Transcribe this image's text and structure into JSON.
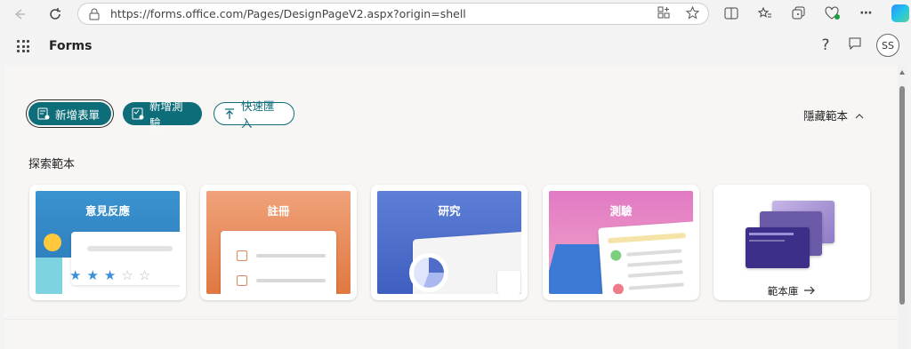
{
  "browser": {
    "url": "https://forms.office.com/Pages/DesignPageV2.aspx?origin=shell"
  },
  "app": {
    "name": "Forms",
    "help_glyph": "?",
    "avatar_initials": "SS"
  },
  "actions": {
    "new_form": "新增表單",
    "new_quiz": "新增測驗",
    "quick_import": "快速匯入",
    "hide_templates": "隱藏範本"
  },
  "templates": {
    "section_title": "探索範本",
    "cards": [
      {
        "label": "意見反應"
      },
      {
        "label": "註冊"
      },
      {
        "label": "研究"
      },
      {
        "label": "測驗"
      },
      {
        "label": "範本庫"
      }
    ]
  },
  "colors": {
    "primary": "#0d6d79",
    "feedback": "#3a93cf",
    "register": "#e98b5a",
    "research": "#5370cc",
    "quiz": "#e27ac4"
  }
}
